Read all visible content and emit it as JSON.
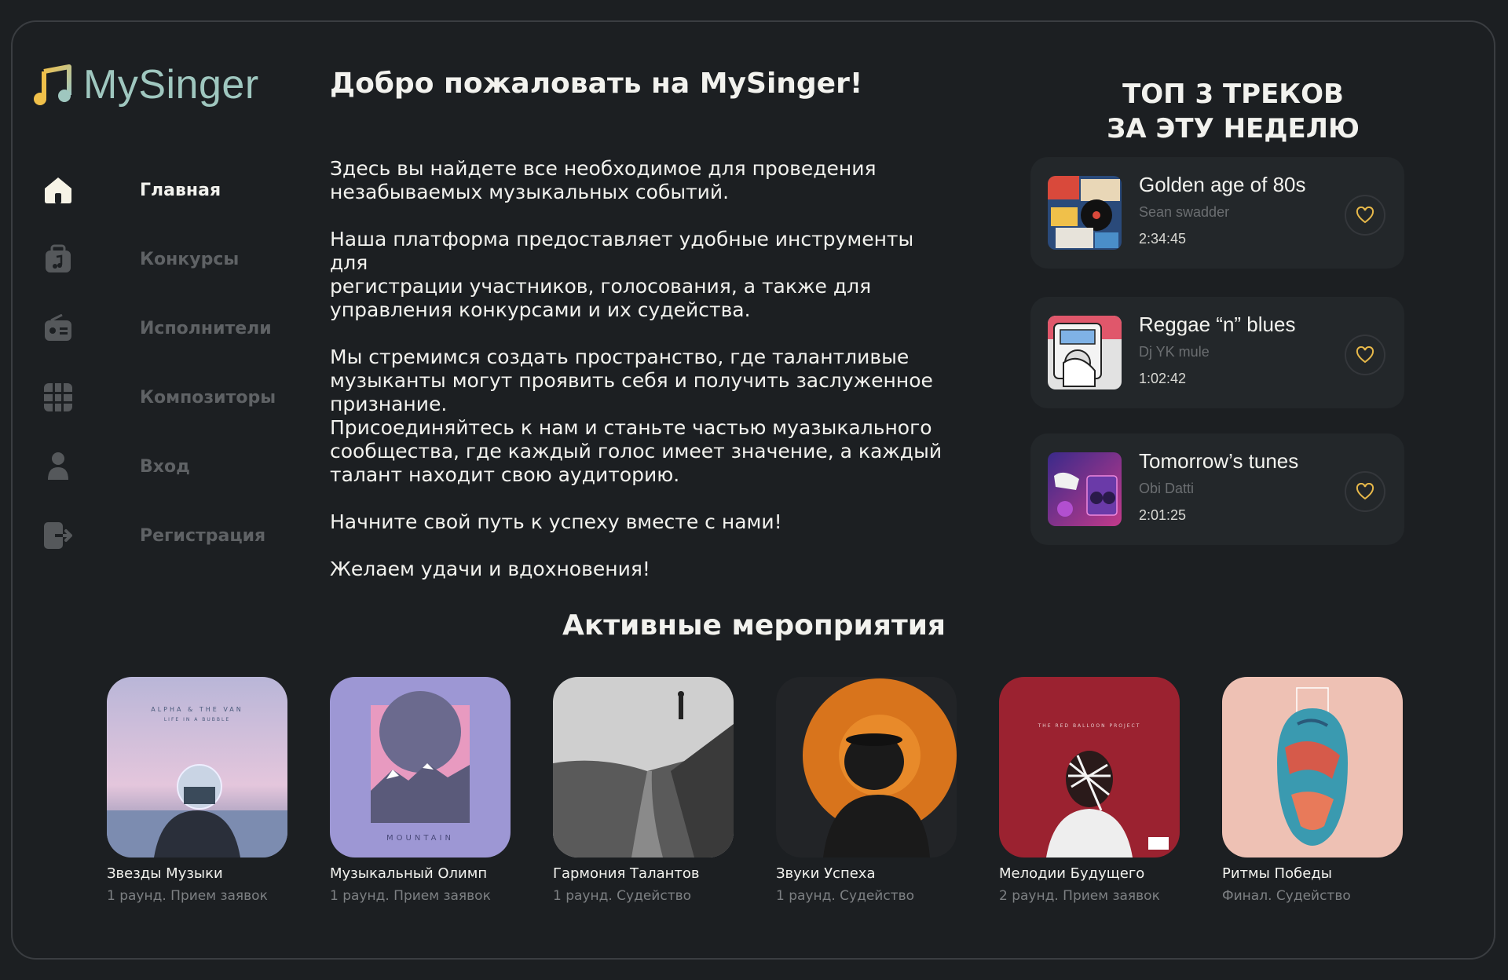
{
  "app": {
    "name": "MySinger"
  },
  "sidebar": {
    "items": [
      {
        "label": "Главная",
        "icon": "home-icon",
        "active": true
      },
      {
        "label": "Конкурсы",
        "icon": "music-bag-icon",
        "active": false
      },
      {
        "label": "Исполнители",
        "icon": "radio-icon",
        "active": false
      },
      {
        "label": "Композиторы",
        "icon": "grid-icon",
        "active": false
      },
      {
        "label": "Вход",
        "icon": "user-icon",
        "active": false
      },
      {
        "label": "Регистрация",
        "icon": "logout-icon",
        "active": false
      }
    ]
  },
  "welcome": {
    "title": "Добро пожаловать на MySinger!",
    "paragraphs": [
      "Здесь вы найдете все необходимое для проведения\nнезабываемых музыкальных событий.",
      "Наша платформа предоставляет удобные инструменты для\nрегистрации участников, голосования, а также для\nуправления конкурсами и их судейства.",
      "Мы стремимся создать пространство, где талантливые\nмузыканты могут проявить себя и получить заслуженное\nпризнание.",
      "Присоединяйтесь к нам и станьте частью муазыкального\nсообщества, где каждый голос имеет значение, а каждый\nталант находит свою аудиторию.",
      "Начните свой путь к успеху вместе с нами!",
      "Желаем удачи и вдохновения!"
    ]
  },
  "top_tracks": {
    "title_line1": "ТОП 3 ТРЕКОВ",
    "title_line2": "ЗА ЭТУ НЕДЕЛЮ",
    "items": [
      {
        "title": "Golden age of 80s",
        "artist": "Sean swadder",
        "duration": "2:34:45"
      },
      {
        "title": "Reggae “n” blues",
        "artist": "Dj YK mule",
        "duration": "1:02:42"
      },
      {
        "title": "Tomorrow’s tunes",
        "artist": "Obi Datti",
        "duration": "2:01:25"
      }
    ]
  },
  "events": {
    "title": "Активные мероприятия",
    "items": [
      {
        "name": "Звезды Музыки",
        "status": "1 раунд. Прием заявок",
        "cover_text": "ALPHA & THE VAN",
        "cover_subtext": "LIFE IN A BUBBLE"
      },
      {
        "name": "Музыкальный Олимп",
        "status": "1 раунд. Прием заявок",
        "cover_text": "MOUNTAIN"
      },
      {
        "name": "Гармония Талантов",
        "status": "1 раунд. Судейство"
      },
      {
        "name": "Звуки Успеха",
        "status": "1 раунд. Судейство"
      },
      {
        "name": "Мелодии Будущего",
        "status": "2 раунд. Прием заявок",
        "cover_text": "THE RED BALLOON PROJECT"
      },
      {
        "name": "Ритмы Победы",
        "status": "Финал. Судейство"
      }
    ]
  },
  "colors": {
    "background": "#1c1f22",
    "card": "#23272a",
    "logo": "#9fc7bf",
    "accent_gold": "#e8b94a",
    "muted": "#5f6265"
  }
}
